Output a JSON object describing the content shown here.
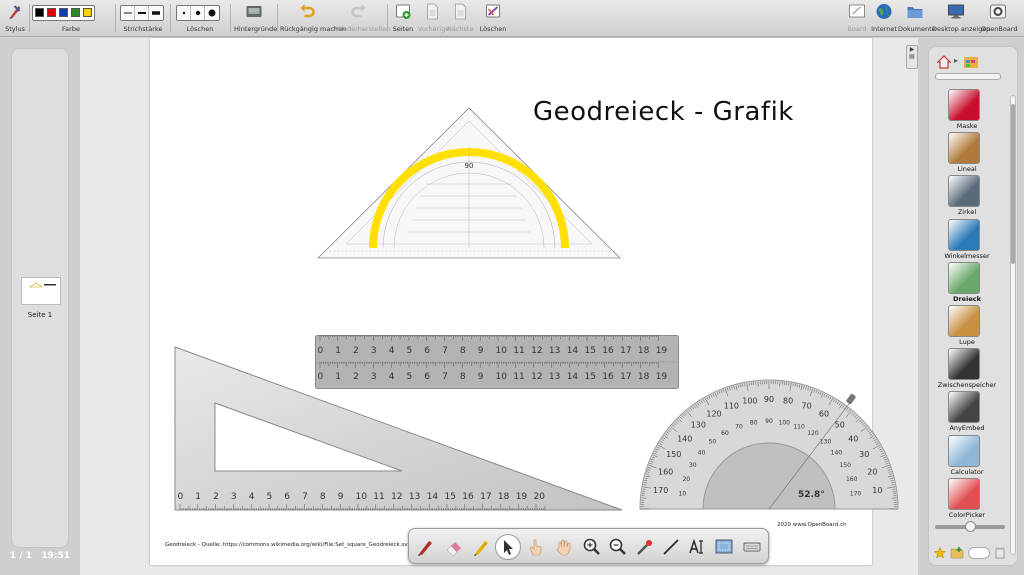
{
  "toolbar": {
    "stylus_label": "Stylus",
    "color_label": "Farbe",
    "colors": [
      "#000000",
      "#e00000",
      "#0a3ea8",
      "#2a8a2a",
      "#ffd000"
    ],
    "stroke_label": "Strichstärke",
    "erase_label": "Löschen",
    "backgrounds_label": "Hintergründe",
    "undo_label": "Rückgängig machen",
    "redo_label": "Wiederherstellen",
    "pages_label": "Seiten",
    "previous_label": "Vorherige",
    "next_label": "Nächste",
    "clear_label": "Löschen",
    "board_label": "Board",
    "internet_label": "Internet",
    "documents_label": "Dokumente",
    "desktop_label": "Desktop anzeigen",
    "app_label": "OpenBoard"
  },
  "pages": {
    "thumbnail_label": "Seite 1",
    "status": "1 / 1",
    "clock": "19:51"
  },
  "board": {
    "title": "Geodreieck - Grafik",
    "source": "Geodreieck - Quelle: https://commons.wikimedia.org/wiki/File:Set_square_Geodreieck.svg",
    "copyright": "2020 www.OpenBoard.ch",
    "protractor_angle": "52.8°"
  },
  "library": {
    "items": [
      {
        "label": "Maske",
        "color": "#c8102e"
      },
      {
        "label": "Lineal",
        "color": "#b07a3a"
      },
      {
        "label": "Zirkel",
        "color": "#5a6a7a"
      },
      {
        "label": "Winkelmesser",
        "color": "#2a7ab8"
      },
      {
        "label": "Dreieck",
        "color": "#6aa86a"
      },
      {
        "label": "Lupe",
        "color": "#c89040"
      },
      {
        "label": "Zwischenspeicher",
        "color": "#333333"
      },
      {
        "label": "AnyEmbed",
        "color": "#444444"
      },
      {
        "label": "Calculator",
        "color": "#8fb8d8"
      },
      {
        "label": "ColorPicker",
        "color": "#e05050"
      }
    ],
    "selected": "Dreieck"
  }
}
